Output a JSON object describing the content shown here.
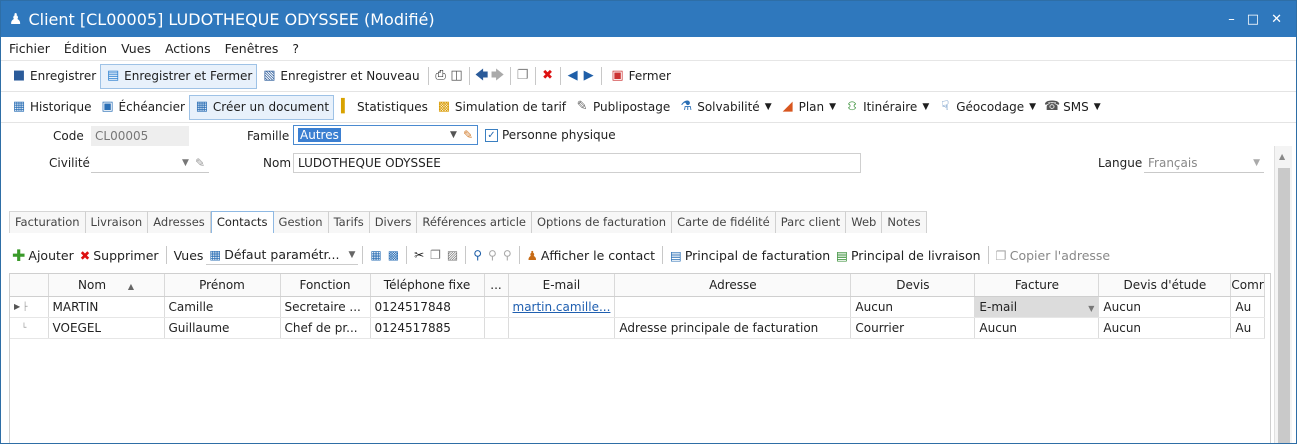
{
  "window": {
    "title": "Client [CL00005] LUDOTHEQUE ODYSSEE (Modifié)"
  },
  "menu": [
    "Fichier",
    "Édition",
    "Vues",
    "Actions",
    "Fenêtres",
    "?"
  ],
  "toolbar": {
    "save": "Enregistrer",
    "save_close": "Enregistrer et Fermer",
    "save_new": "Enregistrer et Nouveau",
    "close": "Fermer"
  },
  "toolbar2": {
    "historique": "Historique",
    "echeancier": "Échéancier",
    "creer_document": "Créer un document",
    "statistiques": "Statistiques",
    "simulation": "Simulation de tarif",
    "publipostage": "Publipostage",
    "solvabilite": "Solvabilité",
    "plan": "Plan",
    "itineraire": "Itinéraire",
    "geocodage": "Géocodage",
    "sms": "SMS"
  },
  "form": {
    "code_label": "Code",
    "code_value": "CL00005",
    "famille_label": "Famille",
    "famille_value": "Autres",
    "personne_label": "Personne physique",
    "civilite_label": "Civilité",
    "nom_label": "Nom",
    "nom_value": "LUDOTHEQUE ODYSSEE",
    "langue_label": "Langue",
    "langue_value": "Français"
  },
  "tabs": [
    "Facturation",
    "Livraison",
    "Adresses",
    "Contacts",
    "Gestion",
    "Tarifs",
    "Divers",
    "Références article",
    "Options de facturation",
    "Carte de fidélité",
    "Parc client",
    "Web",
    "Notes"
  ],
  "active_tab": "Contacts",
  "subtoolbar": {
    "ajouter": "Ajouter",
    "supprimer": "Supprimer",
    "vues": "Vues",
    "vue_value": "Défaut paramétr...",
    "afficher": "Afficher le contact",
    "principal_fact": "Principal de facturation",
    "principal_livr": "Principal de livraison",
    "copier": "Copier l'adresse"
  },
  "grid": {
    "columns": [
      "Nom",
      "Prénom",
      "Fonction",
      "Téléphone fixe",
      "...",
      "E-mail",
      "Adresse",
      "Devis",
      "Facture",
      "Devis d'étude",
      "Comr"
    ],
    "rows": [
      [
        "MARTIN",
        "Camille",
        "Secretaire ...",
        "0124517848",
        "",
        "martin.camille...",
        "",
        "Aucun",
        "E-mail",
        "Aucun",
        "Au"
      ],
      [
        "VOEGEL",
        "Guillaume",
        "Chef de pr...",
        "0124517885",
        "",
        "",
        "Adresse principale de facturation",
        "Courrier",
        "Aucun",
        "Aucun",
        "Au"
      ]
    ]
  }
}
